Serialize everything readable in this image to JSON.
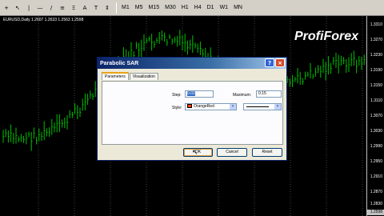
{
  "toolbar": {
    "timeframes": [
      "M1",
      "M5",
      "M15",
      "M30",
      "H1",
      "H4",
      "D1",
      "W1",
      "MN"
    ]
  },
  "chart": {
    "header": "EURUSD,Daily  1.2607 1.2633 1.2563 1.2598",
    "watermark": "ProfiForex",
    "price_ticks": [
      "1.3310",
      "1.3270",
      "1.3230",
      "1.3190",
      "1.3150",
      "1.3110",
      "1.3070",
      "1.3030",
      "1.2990",
      "1.2950",
      "1.2910",
      "1.2870",
      "1.2830"
    ],
    "last_price": "1.2598",
    "candle_color": "#00c000",
    "grid_color": "#808080"
  },
  "dialog": {
    "title": "Parabolic SAR",
    "help_icon": "?",
    "close_icon": "×",
    "tabs": [
      "Parameters",
      "Visualization"
    ],
    "step_label": "Step:",
    "step_value": "0.02",
    "maximum_label": "Maximum:",
    "maximum_value": "0.15",
    "style_label": "Style:",
    "style_color_name": "OrangeRed",
    "style_color_hex": "#ff4500",
    "ok_label": "OK",
    "cancel_label": "Cancel",
    "reset_label": "Reset"
  }
}
